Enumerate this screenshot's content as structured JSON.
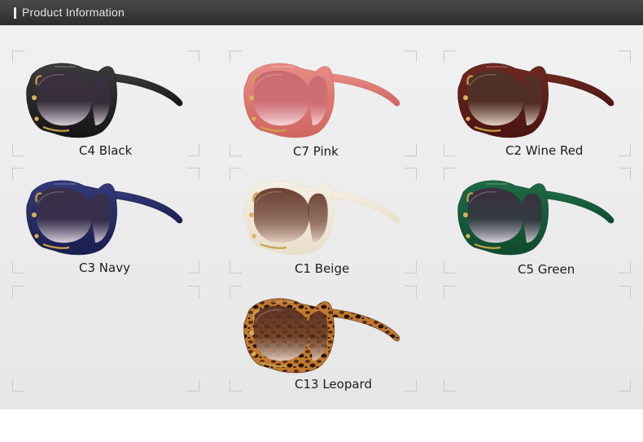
{
  "header": {
    "title": "Product Information"
  },
  "products": [
    {
      "label": "C4 Black",
      "frame": "#151515",
      "frame_hi": "#3c3c3c",
      "lens_top": "#3a2f3e",
      "lens_bottom": "#d8d0d8"
    },
    {
      "label": "C7 Pink",
      "frame": "#d0655f",
      "frame_hi": "#e88c86",
      "lens_top": "#c96a72",
      "lens_bottom": "#f6d6da"
    },
    {
      "label": "C2 Wine Red",
      "frame": "#4a1410",
      "frame_hi": "#6e2a22",
      "lens_top": "#4d3226",
      "lens_bottom": "#e3d2c4"
    },
    {
      "label": "C3 Navy",
      "frame": "#1a1d4e",
      "frame_hi": "#333a78",
      "lens_top": "#3a2f45",
      "lens_bottom": "#d9d0dc"
    },
    {
      "label": "C1 Beige",
      "frame": "#e9dfcc",
      "frame_hi": "#f5efe3",
      "lens_top": "#6b3f30",
      "lens_bottom": "#e4cfc0"
    },
    {
      "label": "C5 Green",
      "frame": "#0f4a2d",
      "frame_hi": "#1e6a45",
      "lens_top": "#3a2f40",
      "lens_bottom": "#d9d1dc"
    },
    {
      "label": "C13 Leopard",
      "frame": "#5a2a10",
      "frame_hi": "#c07a30",
      "lens_top": "#5d3424",
      "lens_bottom": "#e2cbb9",
      "pattern": "leopard"
    }
  ]
}
